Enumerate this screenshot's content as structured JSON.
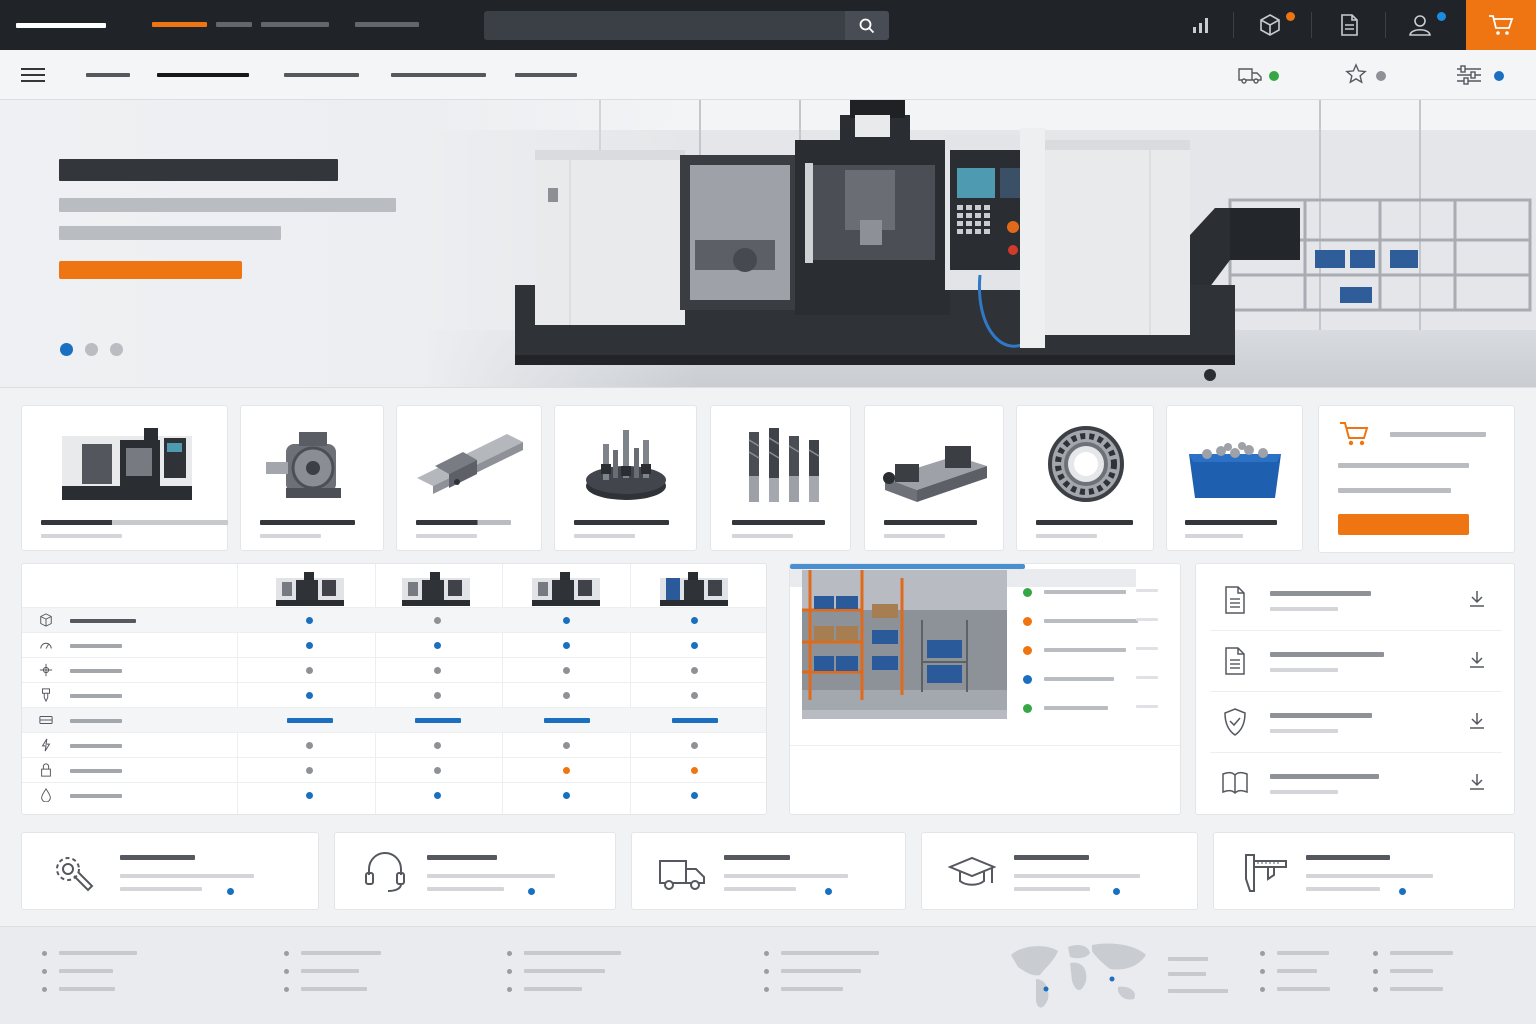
{
  "colors": {
    "accent": "#ee7511",
    "primary_blue": "#1b6fc0",
    "topbar": "#202328",
    "status_green": "#35a845",
    "status_orange": "#ee7511",
    "status_gray": "#8e9196"
  },
  "topbar": {
    "search_icon": "search-icon",
    "actions": [
      {
        "icon": "bar-chart-icon",
        "badge": false
      },
      {
        "icon": "box-icon",
        "badge": true,
        "badge_color": "#ee7511"
      },
      {
        "icon": "document-icon",
        "badge": false
      },
      {
        "icon": "user-icon",
        "badge": true,
        "badge_color": "#1b8de0"
      },
      {
        "icon": "cart-icon",
        "badge": false
      }
    ]
  },
  "subnav": {
    "menu_icon": "hamburger-menu-icon",
    "status_items": [
      {
        "icon": "truck-icon",
        "dot_color": "#35a845"
      },
      {
        "icon": "star-icon",
        "dot_color": "#8e9196"
      },
      {
        "icon": "sliders-icon",
        "dot_color": "#1b6fc0"
      }
    ]
  },
  "hero": {
    "slide_index": 1,
    "slide_count": 3
  },
  "categories": [
    {
      "icon": "cnc-machine-icon"
    },
    {
      "icon": "gearbox-icon"
    },
    {
      "icon": "linear-guide-icon"
    },
    {
      "icon": "tool-holder-icon"
    },
    {
      "icon": "end-mill-icon"
    },
    {
      "icon": "machine-vise-icon"
    },
    {
      "icon": "ball-bearing-icon"
    },
    {
      "icon": "parts-bin-icon"
    }
  ],
  "quick_order": {
    "icon": "cart-icon"
  },
  "compare": {
    "columns": 4,
    "rows": [
      {
        "icon": "cube-icon",
        "cells": [
          "blue",
          "gray",
          "blue",
          "blue"
        ],
        "highlight": true
      },
      {
        "icon": "gauge-icon",
        "cells": [
          "blue",
          "blue",
          "blue",
          "blue"
        ]
      },
      {
        "icon": "axes-icon",
        "cells": [
          "gray",
          "gray",
          "gray",
          "gray"
        ]
      },
      {
        "icon": "spindle-icon",
        "cells": [
          "blue",
          "gray",
          "gray",
          "gray"
        ]
      },
      {
        "icon": "tray-icon",
        "cells": [
          "bar",
          "bar",
          "bar",
          "bar"
        ],
        "highlight": true
      },
      {
        "icon": "power-icon",
        "cells": [
          "gray",
          "gray",
          "gray",
          "gray"
        ]
      },
      {
        "icon": "lock-icon",
        "cells": [
          "gray",
          "gray",
          "orange",
          "orange"
        ]
      },
      {
        "icon": "coolant-drop-icon",
        "cells": [
          "blue",
          "blue",
          "blue",
          "blue"
        ]
      }
    ]
  },
  "stock": {
    "status": [
      "green",
      "orange",
      "orange",
      "blue",
      "green"
    ],
    "progress": 0.68
  },
  "docs": [
    {
      "icon": "document-icon"
    },
    {
      "icon": "document-icon"
    },
    {
      "icon": "shield-icon"
    },
    {
      "icon": "manual-book-icon"
    }
  ],
  "services": [
    {
      "icon": "settings-wrench-icon"
    },
    {
      "icon": "headset-icon"
    },
    {
      "icon": "delivery-truck-icon"
    },
    {
      "icon": "graduation-cap-icon"
    },
    {
      "icon": "caliper-icon"
    }
  ]
}
